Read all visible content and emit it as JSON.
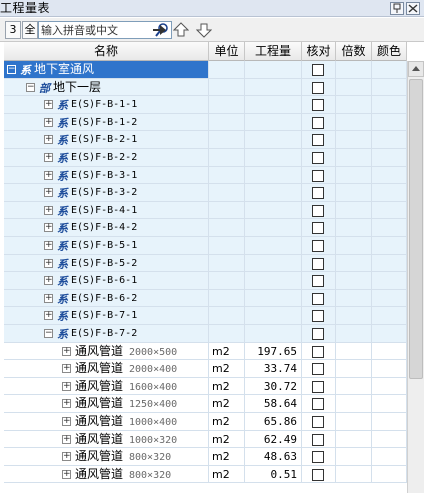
{
  "window": {
    "title": "工程量表",
    "pin_label": "中",
    "close_label": "×"
  },
  "toolbar": {
    "btn_3": "3",
    "btn_all": "全",
    "search_placeholder": "输入拼音或中文",
    "icons": [
      "search-icon",
      "arrow-right-icon",
      "arrow-up-icon",
      "arrow-down-icon"
    ]
  },
  "columns": [
    "名称",
    "单位",
    "工程量",
    "核对",
    "倍数",
    "颜色"
  ],
  "tree": {
    "root": "地下室通风",
    "floor": "地下一层",
    "systems": [
      "E(S)F-B-1-1",
      "E(S)F-B-1-2",
      "E(S)F-B-2-1",
      "E(S)F-B-2-2",
      "E(S)F-B-3-1",
      "E(S)F-B-3-2",
      "E(S)F-B-4-1",
      "E(S)F-B-4-2",
      "E(S)F-B-5-1",
      "E(S)F-B-5-2",
      "E(S)F-B-6-1",
      "E(S)F-B-6-2",
      "E(S)F-B-7-1",
      "E(S)F-B-7-2"
    ],
    "items": [
      {
        "name": "通风管道",
        "size": "2000×500",
        "unit": "m2",
        "qty": "197.65"
      },
      {
        "name": "通风管道",
        "size": "2000×400",
        "unit": "m2",
        "qty": "33.74"
      },
      {
        "name": "通风管道",
        "size": "1600×400",
        "unit": "m2",
        "qty": "30.72"
      },
      {
        "name": "通风管道",
        "size": "1250×400",
        "unit": "m2",
        "qty": "58.64"
      },
      {
        "name": "通风管道",
        "size": "1000×400",
        "unit": "m2",
        "qty": "65.86"
      },
      {
        "name": "通风管道",
        "size": "1000×320",
        "unit": "m2",
        "qty": "62.49"
      },
      {
        "name": "通风管道",
        "size": "800×320",
        "unit": "m2",
        "qty": "48.63"
      },
      {
        "name": "通风管道",
        "size": "800×320",
        "unit": "m2",
        "qty": "0.51"
      }
    ],
    "system_prefix": "系",
    "floor_prefix": "部",
    "root_prefix": "系"
  },
  "colors": {
    "selected": "#2f74cb",
    "row_bg": "#e7f3fb",
    "header_bg": "#dfe6f1"
  }
}
